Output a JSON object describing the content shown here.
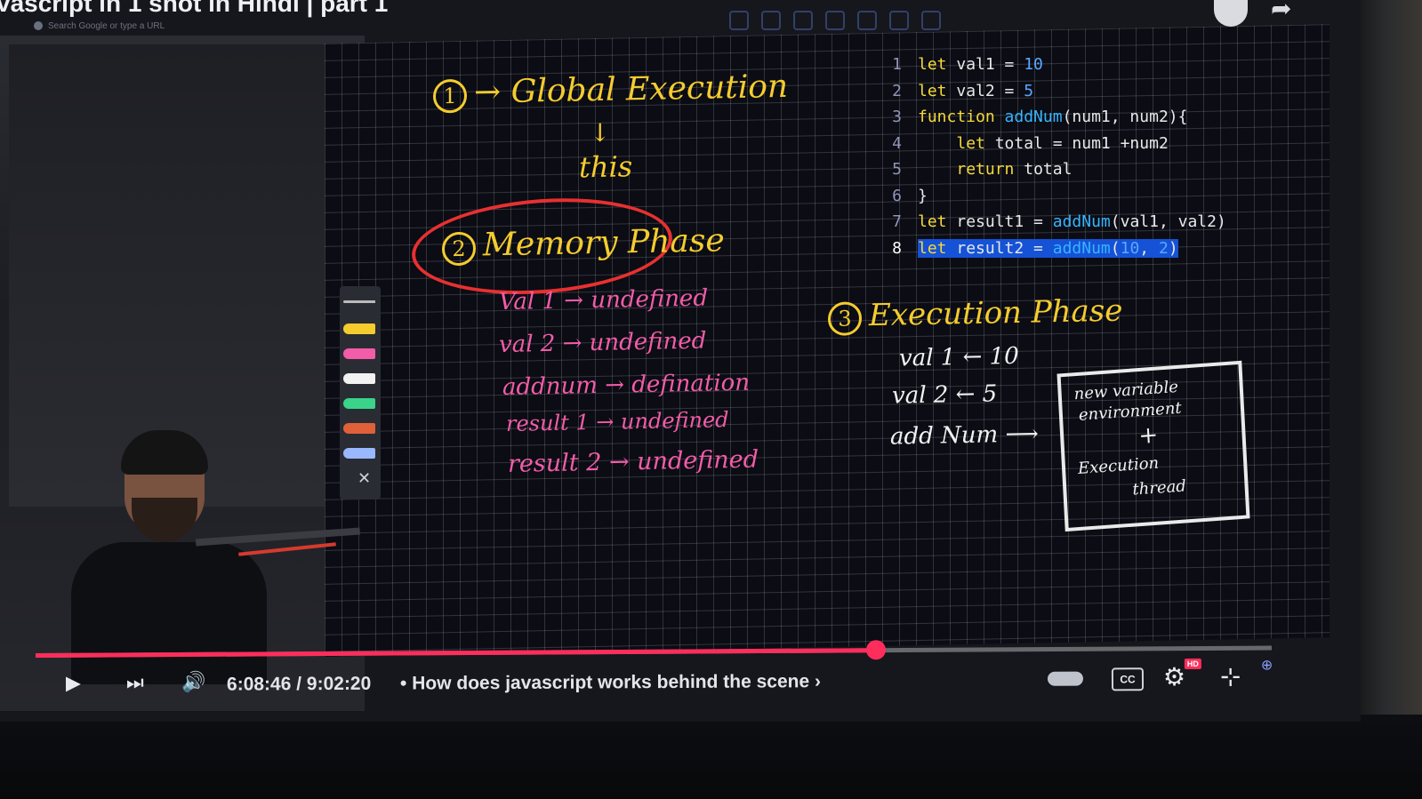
{
  "video": {
    "title_partial": "vascript in 1 shot in Hindi | part 1",
    "browser_search_placeholder": "Search Google or type a URL"
  },
  "board": {
    "step1": {
      "num": "1",
      "text": "→ Global Execution",
      "arrow": "↓",
      "sub": "this"
    },
    "step2": {
      "num": "2",
      "text": "Memory Phase"
    },
    "memory_items": [
      "Val 1 → undefined",
      "val 2 → undefined",
      "addnum → defination",
      "result 1 → undefined",
      "result 2 → undefined"
    ],
    "step3": {
      "num": "3",
      "text": "Execution Phase"
    },
    "exec_items": [
      {
        "name": "val 1",
        "value": "← 10"
      },
      {
        "name": "val 2",
        "value": "← 5"
      },
      {
        "name": "add Num",
        "value": "⟶"
      }
    ],
    "box_lines": [
      "new variable",
      "environment",
      "+",
      "Execution",
      "thread"
    ]
  },
  "code": {
    "lines": [
      {
        "n": "1",
        "tokens": [
          [
            "kw",
            "let"
          ],
          [
            "id",
            " val1 = "
          ],
          [
            "num",
            "10"
          ]
        ]
      },
      {
        "n": "2",
        "tokens": [
          [
            "kw",
            "let"
          ],
          [
            "id",
            " val2 = "
          ],
          [
            "num",
            "5"
          ]
        ]
      },
      {
        "n": "3",
        "tokens": [
          [
            "kw",
            "function"
          ],
          [
            "id",
            " "
          ],
          [
            "fn",
            "addNum"
          ],
          [
            "id",
            "(num1, num2){"
          ]
        ]
      },
      {
        "n": "4",
        "tokens": [
          [
            "id",
            "    "
          ],
          [
            "kw",
            "let"
          ],
          [
            "id",
            " total = num1 +num2"
          ]
        ]
      },
      {
        "n": "5",
        "tokens": [
          [
            "id",
            "    "
          ],
          [
            "kw",
            "return"
          ],
          [
            "id",
            " total"
          ]
        ]
      },
      {
        "n": "6",
        "tokens": [
          [
            "id",
            "}"
          ]
        ]
      },
      {
        "n": "7",
        "tokens": [
          [
            "kw",
            "let"
          ],
          [
            "id",
            " result1 = "
          ],
          [
            "fn",
            "addNum"
          ],
          [
            "id",
            "(val1, val2)"
          ]
        ]
      },
      {
        "n": "8",
        "tokens": [
          [
            "kw",
            "let"
          ],
          [
            "id",
            " result2 = "
          ],
          [
            "fn",
            "addNum"
          ],
          [
            "id",
            "("
          ],
          [
            "num",
            "10"
          ],
          [
            "id",
            ", "
          ],
          [
            "num",
            "2"
          ],
          [
            "id",
            ")"
          ]
        ],
        "selected": true
      }
    ]
  },
  "player": {
    "time": "6:08:46 / 9:02:20",
    "chapter": "• How does javascript works behind the scene ›",
    "progress_fraction": 0.68,
    "cc_label": "CC",
    "hd_label": "HD"
  },
  "icons": {
    "play": "play-icon",
    "next": "next-icon",
    "volume": "volume-icon",
    "settings": "gear-icon",
    "fullscreen": "exit-fullscreen-icon"
  }
}
